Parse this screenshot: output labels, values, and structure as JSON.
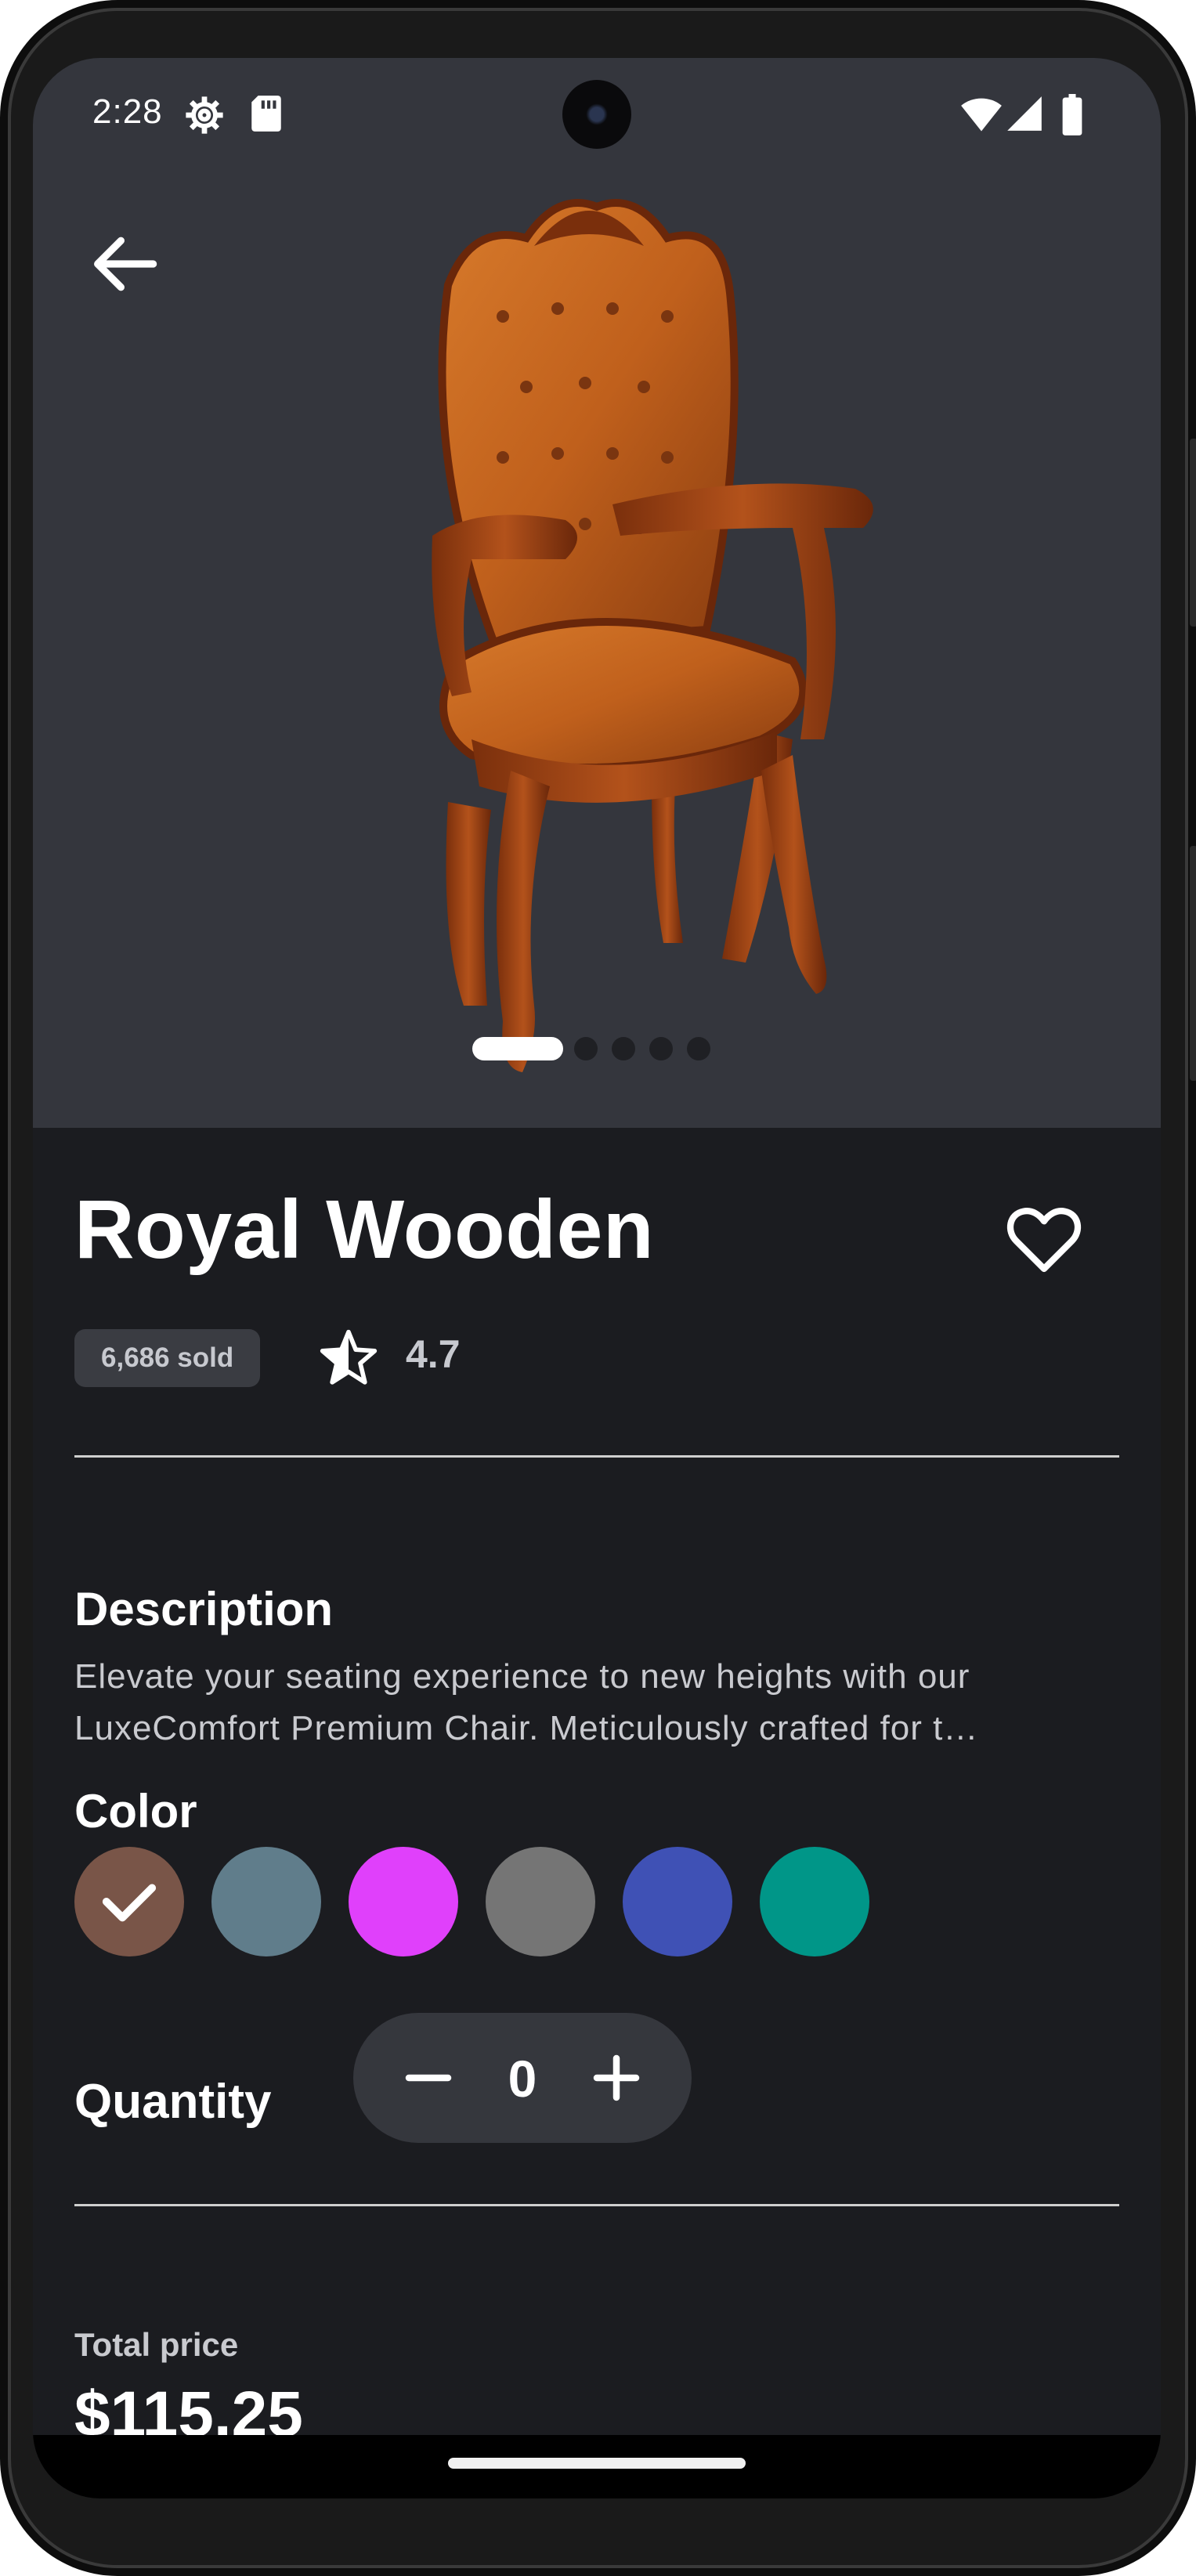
{
  "status_bar": {
    "time": "2:28",
    "icons": [
      "settings-gear-icon",
      "sd-card-icon",
      "wifi-icon",
      "cell-signal-icon",
      "battery-icon"
    ]
  },
  "hero": {
    "image_name": "royal-wooden-chair-image",
    "carousel_pages": 5,
    "carousel_active_index": 0,
    "background_color": "#34363d"
  },
  "product": {
    "title": "Royal Wooden",
    "sold": "6,686 sold",
    "rating": "4.7"
  },
  "description": {
    "heading": "Description",
    "line1": "Elevate your seating experience to new heights with our",
    "line2": "LuxeComfort Premium Chair. Meticulously crafted for t…"
  },
  "color": {
    "heading": "Color",
    "selected_index": 0,
    "options": [
      "#795548",
      "#607d8b",
      "#e040fb",
      "#757575",
      "#3f51b5",
      "#009688"
    ]
  },
  "quantity": {
    "label": "Quantity",
    "value": "0"
  },
  "total": {
    "label": "Total price",
    "value": "$115.25"
  },
  "theme": {
    "background": "#1b1c20",
    "text": "#ffffff",
    "muted_text": "#c9cacf",
    "stepper_bg": "#35373d"
  }
}
